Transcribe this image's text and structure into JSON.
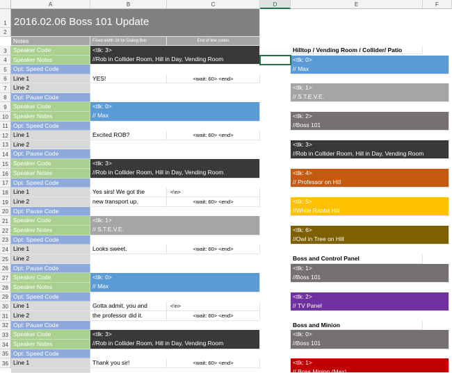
{
  "columns": [
    {
      "label": "A"
    },
    {
      "label": "B"
    },
    {
      "label": "C"
    },
    {
      "label": "D"
    },
    {
      "label": "E"
    },
    {
      "label": "F"
    }
  ],
  "rows": [
    "1",
    "2",
    "3",
    "4",
    "5",
    "6",
    "7",
    "8",
    "9",
    "10",
    "11",
    "12",
    "13",
    "14",
    "15",
    "16",
    "17",
    "18",
    "19",
    "20",
    "21",
    "22",
    "23",
    "24",
    "25",
    "26",
    "27",
    "28",
    "29",
    "30",
    "31",
    "32",
    "33",
    "34",
    "35",
    "36"
  ],
  "title": "2016.02.06 Boss 101 Update",
  "notes_row": {
    "a": "Notes",
    "b": "Fixed width 28 for Dialog Box",
    "c": "End of line codes"
  },
  "labels": {
    "speaker_code": "Speaker Code",
    "speaker_notes": "Speaker Notes",
    "opt_speed_code": "Opt: Speed Code",
    "opt_pause_code": "Opt: Pause Code",
    "line1": "Line 1",
    "line2": "Line 2"
  },
  "dialog": {
    "r4_code": "<tlk: 3>",
    "r4_notes": "//Rob in Collider Room, Hill in Day, Vending Room",
    "r6_line": "YES!",
    "r6_wait": "<wait: 60> <end>",
    "r9_code": "<tlk: 0>",
    "r10_notes": "// Max",
    "r12_line": "Excited ROB?",
    "r12_wait": "<wait: 60> <end>",
    "r15_code": "<tlk: 3>",
    "r16_notes": "//Rob in Collider Room, Hill in Day, Vending Room",
    "r18_line": "Yes sirs! We got the",
    "r18_code": "<\\n>",
    "r19_line": "new transport up.",
    "r19_wait": "<wait: 60> <end>",
    "r21_code": "<tlk: 1>",
    "r22_notes": "// S.T.E.V.E.",
    "r24_line": "Looks sweet.",
    "r24_wait": "<wait: 60> <end>",
    "r27_code": "<tlk: 0>",
    "r28_notes": "// Max",
    "r30_line": "Gotta admit, you and",
    "r30_code": "<\\n>",
    "r31_line": "the professor did it.",
    "r31_wait": "<wait: 60> <end>",
    "r33_code": "<tlk: 3>",
    "r34_notes": "//Rob in Collider Room, Hill in Day, Vending Room",
    "r36_line": "Thank you sir!",
    "r36_wait": "<wait: 60> <end>"
  },
  "right_panel": {
    "heading1": "Hilltop / Vending Room / Collider/ Patio",
    "heading2": "Boss and Control Panel",
    "heading3": "Boss and Minion",
    "items": [
      {
        "code": "<tlk: 0>",
        "name": "// Max",
        "color": "#5b9bd5"
      },
      {
        "code": "<tlk: 1>",
        "name": "// S.T.E.V.E.",
        "color": "#a5a5a5"
      },
      {
        "code": "<tlk: 2>",
        "name": "//Boss 101",
        "color": "#767171"
      },
      {
        "code": "<tlk: 3>",
        "name": "//Rob in Collider Room, Hill in Day, Vending Room",
        "color": "#3a3838"
      },
      {
        "code": "<tlk: 4>",
        "name": "// Professor on Hill",
        "color": "#c55a11"
      },
      {
        "code": "<tlk: 5>",
        "name": "//White Rabbit Hill",
        "color": "#ffc000"
      },
      {
        "code": "<tlk: 6>",
        "name": "//Owl in Tree on Hill",
        "color": "#7f6000"
      },
      {
        "code": "<tlk: 1>",
        "name": "//Boss 101",
        "color": "#767171"
      },
      {
        "code": "<tlk: 2>",
        "name": "// TV Panel",
        "color": "#7030a0"
      },
      {
        "code": "<tlk: 0>",
        "name": "//Boss 101",
        "color": "#767171"
      },
      {
        "code": "<tlk: 1>",
        "name": "// Boss Minion (Max)",
        "color": "#c00000"
      }
    ]
  },
  "colors": {
    "green": "#a9d08e",
    "blue": "#8ea9db",
    "max_blue": "#5b9bd5",
    "rob_dark": "#3a3838",
    "steve_gray": "#a5a5a5",
    "title_gray": "#808080"
  }
}
